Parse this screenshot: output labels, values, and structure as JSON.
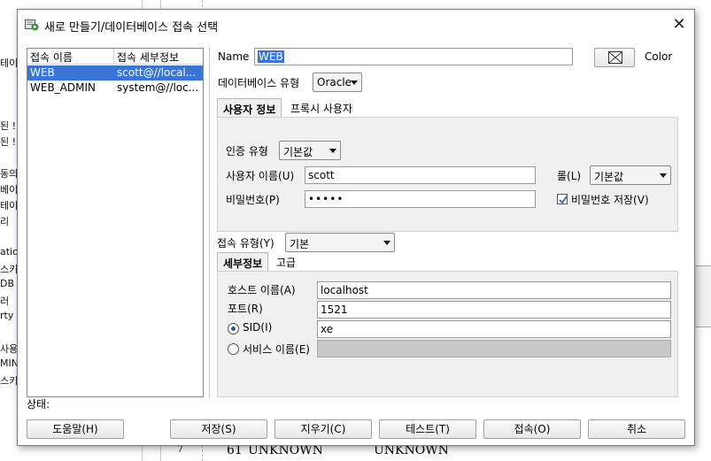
{
  "background": {
    "left_fragments": [
      "테이",
      "된 !",
      "된 !",
      "동의(",
      "베이",
      "테이",
      "리",
      "atio",
      "스키",
      "DB 7",
      "러",
      "rty (",
      "사용",
      "MIN",
      "스키"
    ],
    "grid_row": {
      "index": "7",
      "id": "61",
      "name": "UNKNOWN",
      "name2": "UNKNOWN"
    }
  },
  "dialog": {
    "title": "새로 만들기/데이터베이스 접속 선택",
    "close_icon": "close-icon",
    "connections": {
      "columns": [
        "접속 이름",
        "접속 세부정보"
      ],
      "rows": [
        {
          "name": "WEB",
          "details": "scott@//local...",
          "selected": true
        },
        {
          "name": "WEB_ADMIN",
          "details": "system@//loc...",
          "selected": false
        }
      ]
    },
    "status_label": "상태:",
    "form": {
      "name_label": "Name",
      "name_value": "WEB",
      "color_label": "Color",
      "db_type_label": "데이터베이스 유형",
      "db_type_value": "Oracle",
      "tabs": [
        "사용자 정보",
        "프록시 사용자"
      ],
      "auth_type_label": "인증 유형",
      "auth_type_value": "기본값",
      "username_label": "사용자 이름(U)",
      "username_value": "scott",
      "role_label": "롤(L)",
      "role_value": "기본값",
      "password_label": "비밀번호(P)",
      "password_value": "•••••",
      "save_password_label": "비밀번호 저장(V)",
      "save_password_checked": true,
      "conn_type_label": "접속 유형(Y)",
      "conn_type_value": "기본",
      "detail_tabs": [
        "세부정보",
        "고급"
      ],
      "host_label": "호스트 이름(A)",
      "host_value": "localhost",
      "port_label": "포트(R)",
      "port_value": "1521",
      "sid_label": "SID(I)",
      "sid_value": "xe",
      "sid_selected": true,
      "service_label": "서비스 이름(E)",
      "service_value": ""
    },
    "buttons": {
      "help": "도움말(H)",
      "save": "저장(S)",
      "clear": "지우기(C)",
      "test": "테스트(T)",
      "connect": "접속(O)",
      "cancel": "취소"
    }
  }
}
